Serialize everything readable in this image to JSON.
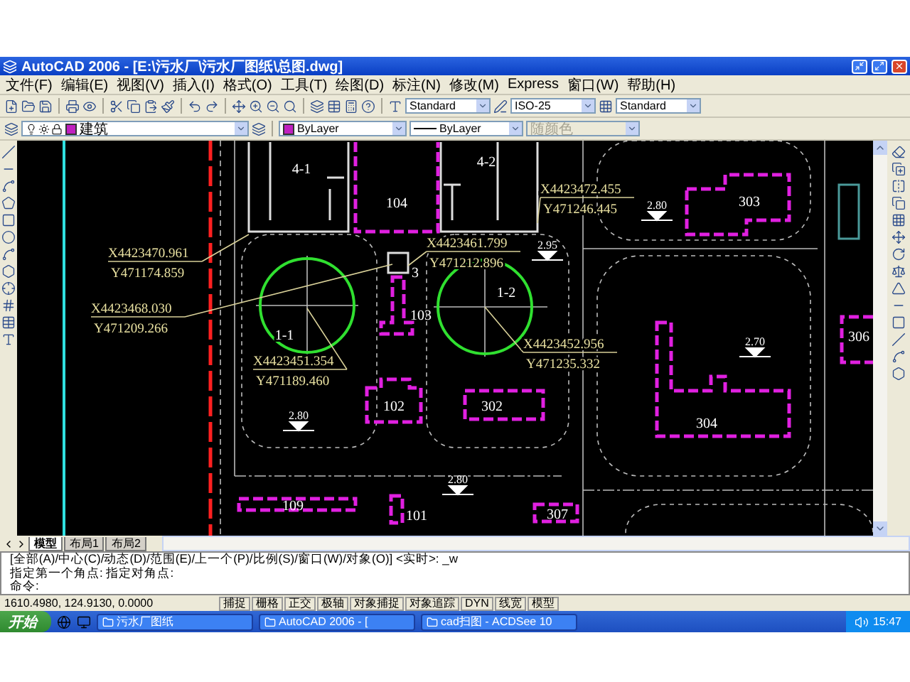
{
  "window": {
    "title": "AutoCAD 2006 - [E:\\污水厂\\污水厂图纸\\总图.dwg]"
  },
  "menu": [
    "文件(F)",
    "编辑(E)",
    "视图(V)",
    "插入(I)",
    "格式(O)",
    "工具(T)",
    "绘图(D)",
    "标注(N)",
    "修改(M)",
    "Express",
    "窗口(W)",
    "帮助(H)"
  ],
  "styles": {
    "text_style": "Standard",
    "dim_style": "ISO-25",
    "table_style": "Standard"
  },
  "properties": {
    "layer": "建筑",
    "color_setting": "ByLayer",
    "linetype": "ByLayer",
    "lineweight": "随颜色"
  },
  "drawing": {
    "structures": [
      {
        "label": "4-1"
      },
      {
        "label": "4-2"
      },
      {
        "label": "3"
      }
    ],
    "buildings": [
      {
        "label": "104"
      },
      {
        "label": "303"
      },
      {
        "label": "306"
      },
      {
        "label": "103"
      },
      {
        "label": "102"
      },
      {
        "label": "302"
      },
      {
        "label": "304"
      },
      {
        "label": "109"
      },
      {
        "label": "101"
      },
      {
        "label": "307"
      }
    ],
    "tanks": [
      {
        "label": "1-1"
      },
      {
        "label": "1-2"
      }
    ],
    "coordinates": [
      {
        "x": "X4423470.961",
        "y": "Y471174.859"
      },
      {
        "x": "X4423468.030",
        "y": "Y471209.266"
      },
      {
        "x": "X4423461.799",
        "y": "Y471212.896"
      },
      {
        "x": "X4423472.455",
        "y": "Y471246.445"
      },
      {
        "x": "X4423451.354",
        "y": "Y471189.460"
      },
      {
        "x": "X4423452.956",
        "y": "Y471235.332"
      }
    ],
    "elevations": [
      "2.80",
      "2.95",
      "2.70",
      "2.80",
      "2.80"
    ]
  },
  "layout_tabs": [
    {
      "label": "模型",
      "selected": true
    },
    {
      "label": "布局1",
      "selected": false
    },
    {
      "label": "布局2",
      "selected": false
    }
  ],
  "command_lines": [
    "[全部(A)/中心(C)/动态(D)/范围(E)/上一个(P)/比例(S)/窗口(W)/对象(O)] <实时>: _w",
    "指定第一个角点: 指定对角点:",
    "命令:"
  ],
  "status_bar": {
    "coordinates": "1610.4980, 124.9130, 0.0000",
    "toggles": [
      "捕捉",
      "栅格",
      "正交",
      "极轴",
      "对象捕捉",
      "对象追踪",
      "DYN",
      "线宽",
      "模型"
    ]
  },
  "taskbar": {
    "start": "开始",
    "tasks": [
      "污水厂图纸",
      "AutoCAD 2006 - [",
      "cad扫图 - ACDSee 10"
    ],
    "clock": "15:47"
  }
}
